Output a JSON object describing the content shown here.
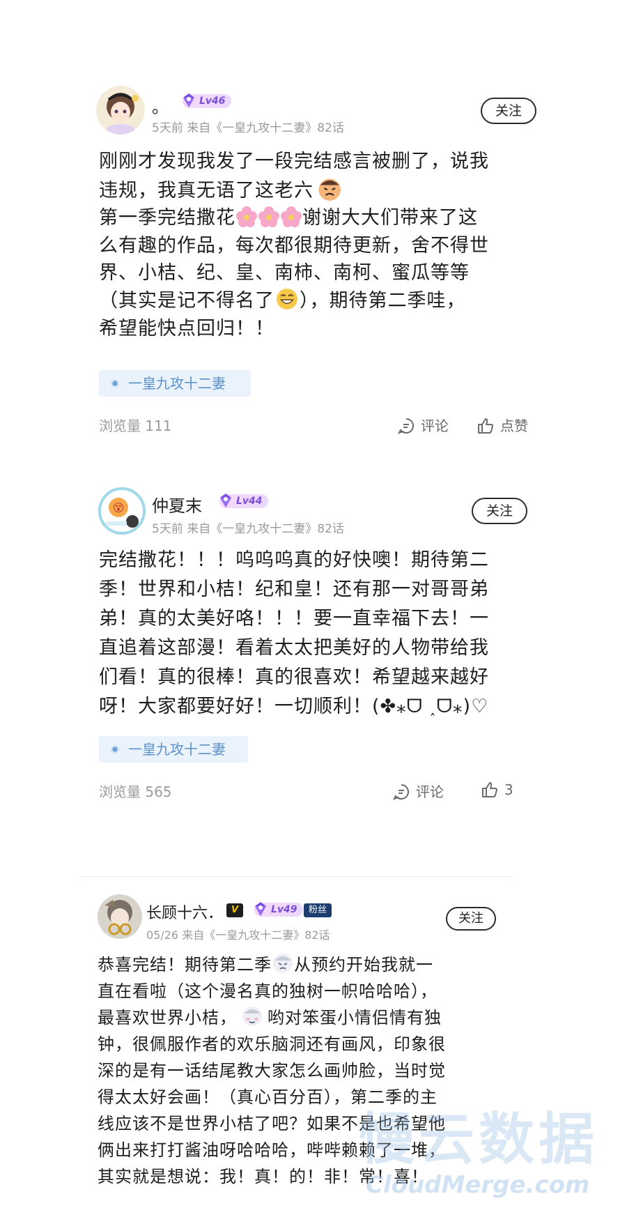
{
  "posts": [
    {
      "username": "。",
      "level": "Lv46",
      "meta": "5天前 来自《一皇九攻十二妻》82话",
      "follow_label": "关注",
      "content_lines": [
        "刚刚才发现我发了一段完结感言被删了，说我",
        "违规，我真无语了这老六",
        "第一季完结撒花",
        "谢谢大大们带来了这",
        "么有趣的作品，每次都很期待更新，舍不得世",
        "界、小桔、纪、皇、南柿、南柯、蜜瓜等等",
        "（其实是记不得名了",
        "），期待第二季哇，",
        "希望能快点回归！！"
      ],
      "topic": "一皇九攻十二妻",
      "views": "浏览量 111",
      "comment_label": "评论",
      "like_label": "点赞"
    },
    {
      "username": "仲夏末",
      "level": "Lv44",
      "meta": "5天前 来自《一皇九攻十二妻》82话",
      "follow_label": "关注",
      "content_lines": [
        "完结撒花！！！呜呜呜真的好快噢！期待第二",
        "季！世界和小桔！纪和皇！还有那一对哥哥弟",
        "弟！真的太美好咯！！！要一直幸福下去！一",
        "直追着这部漫！看着太太把美好的人物带给我",
        "们看！真的很棒！真的很喜欢！希望越来越好",
        "呀！大家都要好好！一切顺利！(✤⁎ᗜ ˰ᗜ⁎)♡"
      ],
      "topic": "一皇九攻十二妻",
      "views": "浏览量 565",
      "comment_label": "评论",
      "like_label": "3"
    },
    {
      "username": "长顾十六．",
      "v_badge": "V",
      "level": "Lv49",
      "fan_badge": "粉丝",
      "meta": "05/26 来自《一皇九攻十二妻》82话",
      "follow_label": "关注",
      "content_lines": [
        "恭喜完结！期待第二季",
        "从预约开始我就一",
        "直在看啦（这个漫名真的独树一帜哈哈哈），",
        "最喜欢世界小桔，",
        "哟对笨蛋小情侣情有独",
        "钟，很佩服作者的欢乐脑洞还有画风，印象很",
        "深的是有一话结尾教大家怎么画帅脸，当时觉",
        "得太太好会画！（真心百分百），第二季的主",
        "线应该不是世界小桔了吧？如果不是也希望他",
        "俩出来打打酱油呀哈哈哈，哔哔赖赖了一堆，",
        "其实就是想说：我！真！的！非！常！喜！"
      ]
    }
  ],
  "watermark": {
    "main": "慢云数据",
    "sub": "CloudMerge.com"
  }
}
